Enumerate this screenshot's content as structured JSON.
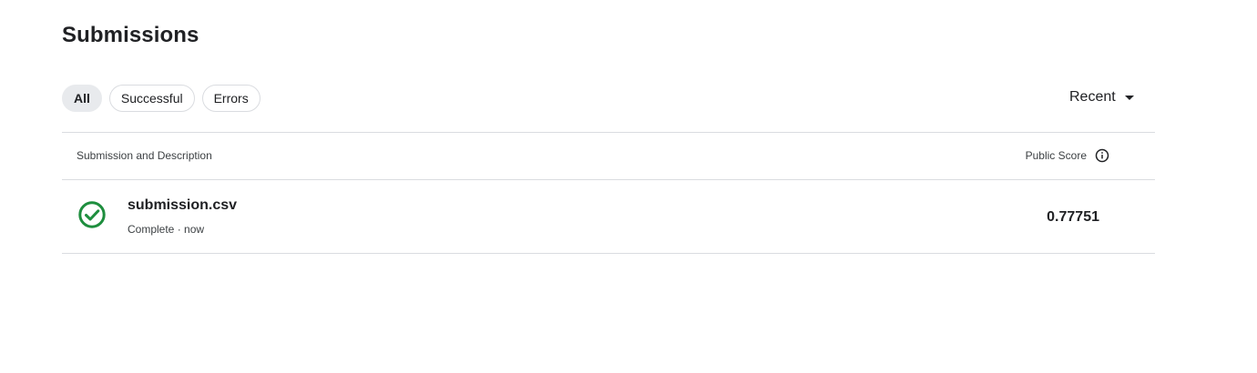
{
  "page": {
    "title": "Submissions"
  },
  "filters": {
    "items": [
      {
        "label": "All",
        "active": true
      },
      {
        "label": "Successful",
        "active": false
      },
      {
        "label": "Errors",
        "active": false
      }
    ]
  },
  "sort": {
    "label": "Recent",
    "icon": "caret-down-icon"
  },
  "table": {
    "columns": {
      "left": "Submission and Description",
      "right": "Public Score",
      "right_icon": "info-icon"
    },
    "rows": [
      {
        "file_name": "submission.csv",
        "status": "Complete",
        "separator": "·",
        "time": "now",
        "score": "0.77751",
        "status_icon": "check-circle-icon",
        "status_color": "#1e8e3e"
      }
    ]
  },
  "colors": {
    "text": "#202124",
    "muted": "#3c4043",
    "border": "#dadce0",
    "active_chip": "#e8eaed",
    "success": "#1e8e3e"
  }
}
